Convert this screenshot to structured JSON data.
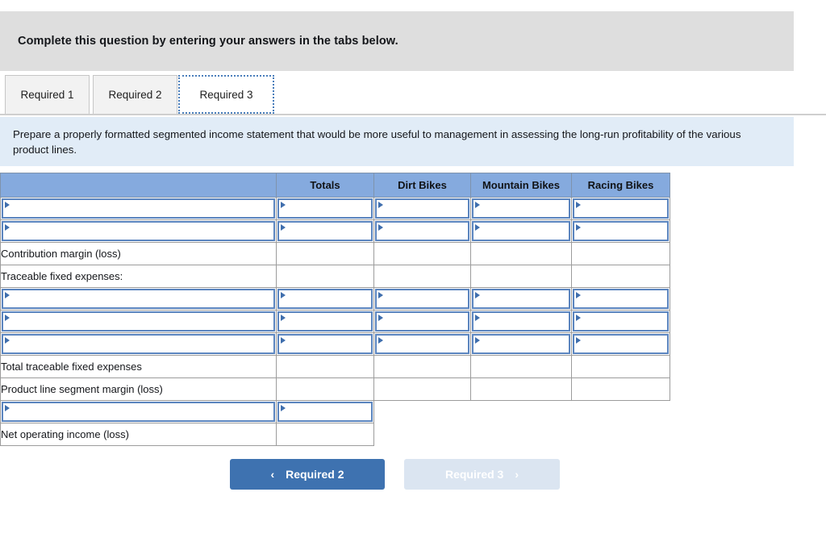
{
  "header": {
    "instruction": "Complete this question by entering your answers in the tabs below."
  },
  "tabs": [
    {
      "label": "Required 1",
      "active": false
    },
    {
      "label": "Required 2",
      "active": false
    },
    {
      "label": "Required 3",
      "active": true
    }
  ],
  "requirement": {
    "text": "Prepare a properly formatted segmented income statement that would be more useful to management in assessing the long-run profitability of the various product lines."
  },
  "table": {
    "columns": [
      "",
      "Totals",
      "Dirt Bikes",
      "Mountain Bikes",
      "Racing Bikes"
    ],
    "rows": [
      {
        "label": "",
        "type": "dropdown",
        "cells": [
          "dropdown",
          "dropdown",
          "dropdown",
          "dropdown"
        ]
      },
      {
        "label": "",
        "type": "dropdown",
        "cells": [
          "dropdown",
          "dropdown",
          "dropdown",
          "dropdown"
        ]
      },
      {
        "label": "Contribution margin (loss)",
        "type": "text",
        "cells": [
          "blank",
          "blank",
          "blank",
          "blank"
        ]
      },
      {
        "label": "Traceable fixed expenses:",
        "type": "text",
        "cells": [
          "blank",
          "blank",
          "blank",
          "blank"
        ]
      },
      {
        "label": "",
        "type": "dropdown",
        "cells": [
          "dropdown",
          "dropdown",
          "dropdown",
          "dropdown"
        ]
      },
      {
        "label": "",
        "type": "dropdown",
        "cells": [
          "dropdown",
          "dropdown",
          "dropdown",
          "dropdown"
        ]
      },
      {
        "label": "",
        "type": "dropdown",
        "cells": [
          "dropdown",
          "dropdown",
          "dropdown",
          "dropdown"
        ]
      },
      {
        "label": "Total traceable fixed expenses",
        "type": "text",
        "cells": [
          "blank",
          "blank",
          "blank",
          "blank"
        ]
      },
      {
        "label": "Product line segment margin (loss)",
        "type": "text",
        "cells": [
          "blank",
          "blank",
          "blank",
          "blank"
        ]
      },
      {
        "label": "",
        "type": "dropdown",
        "cells": [
          "dropdown",
          "void",
          "void",
          "void"
        ]
      },
      {
        "label": "Net operating income (loss)",
        "type": "text",
        "cells": [
          "blank",
          "void",
          "void",
          "void"
        ]
      }
    ]
  },
  "nav": {
    "prev_label": "Required 2",
    "prev_chevron": "‹",
    "next_label": "Required 3",
    "next_chevron": "›"
  },
  "colors": {
    "header_blue": "#85aade",
    "banner_blue": "#e1ecf7",
    "banner_gray": "#dedede",
    "input_border": "#5b85bf",
    "button_primary": "#3e72b0",
    "button_disabled": "#dbe5f1"
  }
}
